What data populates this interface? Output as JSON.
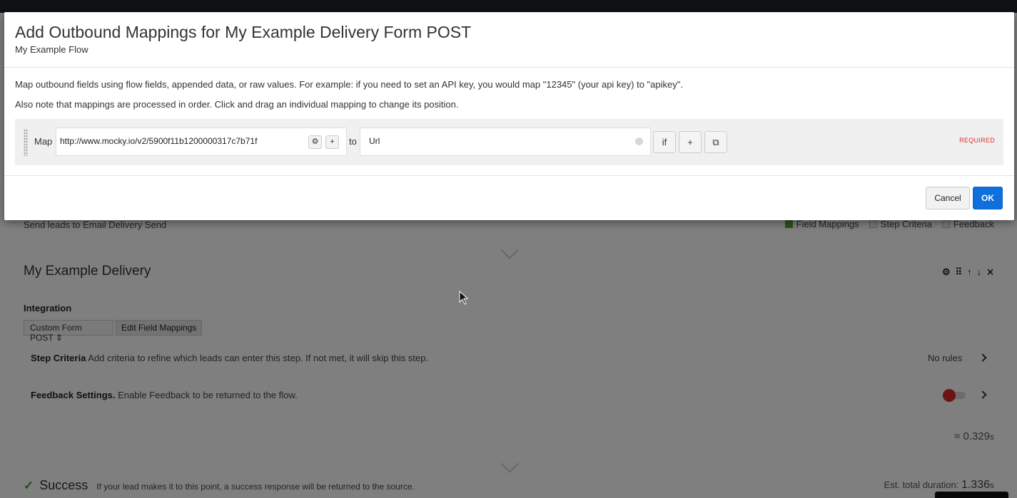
{
  "modal": {
    "title": "Add Outbound Mappings for My Example Delivery Form POST",
    "subtitle": "My Example Flow",
    "note1": "Map outbound fields using flow fields, appended data, or raw values. For example: if you need to set an API key, you would map \"12345\" (your api key) to \"apikey\".",
    "note2": "Also note that mappings are processed in order. Click and drag an individual mapping to change its position.",
    "mapping": {
      "map_label": "Map",
      "source_value": "http://www.mocky.io/v2/5900f11b1200000317c7b71f",
      "settings_icon": "gear-icon",
      "add_source_label": "+",
      "to_label": "to",
      "target_value": "Url",
      "if_label": "if",
      "add_label": "+",
      "copy_icon": "copy-icon",
      "required_label": "REQUIRED"
    },
    "cancel_label": "Cancel",
    "ok_label": "OK"
  },
  "background": {
    "send_text": "Send leads to Email Delivery Send",
    "legend": [
      {
        "label": "Field Mappings",
        "checked": true
      },
      {
        "label": "Step Criteria",
        "checked": false
      },
      {
        "label": "Feedback",
        "checked": false
      }
    ],
    "step_title": "My Example Delivery",
    "step_tool_icons": [
      "gear-icon",
      "grip-icon",
      "arrow-up-icon",
      "arrow-down-icon",
      "collapse-icon"
    ],
    "integration_label": "Integration",
    "integration_select": "Custom Form POST",
    "edit_field_mappings": "Edit Field Mappings",
    "step_criteria_title": "Step Criteria",
    "step_criteria_desc": "Add criteria to refine which leads can enter this step. If not met, it will skip this step.",
    "step_criteria_value": "No rules",
    "feedback_title": "Feedback Settings.",
    "feedback_desc": "Enable Feedback to be returned to the flow.",
    "timing_prefix": "≈ ",
    "timing_value": "0.329",
    "timing_unit": "s",
    "success_title": "Success",
    "success_desc": "If your lead makes it to this point, a success response will be returned to the source.",
    "est_label": "Est. total duration: ",
    "est_value": "1.336",
    "est_unit": "s"
  },
  "colors": {
    "accent": "#0f6fdc",
    "required": "#d0342c",
    "success": "#3aa13a",
    "toggle_off": "#d9262c",
    "legend_on": "#5aa43a"
  }
}
